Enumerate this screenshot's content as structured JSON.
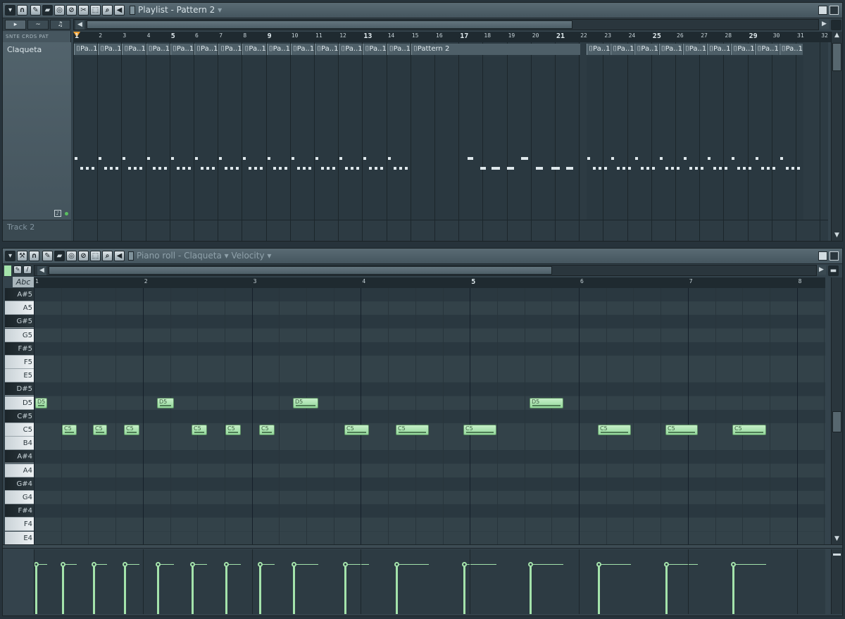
{
  "playlist": {
    "title": "Playlist",
    "title_sep": " - ",
    "pattern": "Pattern 2",
    "modes": "SNTE  CRDS  PAT",
    "tracks": [
      "Claqueta",
      "Track 2"
    ],
    "bars": [
      "1",
      "2",
      "3",
      "4",
      "5",
      "6",
      "7",
      "8",
      "9",
      "10",
      "11",
      "12",
      "13",
      "14",
      "15",
      "16",
      "17",
      "18",
      "19",
      "20",
      "21",
      "22",
      "23",
      "24",
      "25",
      "26",
      "27",
      "28",
      "29",
      "30",
      "31",
      "32"
    ],
    "clip_short": "Pa..1",
    "clip_long": "Pattern 2"
  },
  "pianoroll": {
    "title": "Piano roll",
    "channel": "Claqueta",
    "target": "Velocity",
    "abc": "Abc",
    "keys": [
      "A#5",
      "A5",
      "G#5",
      "G5",
      "F#5",
      "F5",
      "E5",
      "D#5",
      "D5",
      "C#5",
      "C5",
      "B4",
      "A#4",
      "A4",
      "G#4",
      "G4",
      "F#4",
      "F4",
      "E4"
    ],
    "bars": [
      "1",
      "2",
      "3",
      "4",
      "5",
      "6",
      "7",
      "8"
    ],
    "notes": [
      {
        "label": "D5"
      },
      {
        "label": "C5"
      },
      {
        "label": "C5"
      },
      {
        "label": "C5"
      },
      {
        "label": "D5"
      },
      {
        "label": "C5"
      },
      {
        "label": "C5"
      },
      {
        "label": "C5"
      },
      {
        "label": "D5"
      },
      {
        "label": "C5"
      },
      {
        "label": "C5"
      },
      {
        "label": "C5"
      },
      {
        "label": "D5"
      },
      {
        "label": "C5"
      },
      {
        "label": "C5"
      },
      {
        "label": "C5"
      }
    ]
  },
  "colors": {
    "note": "#a4e3ab",
    "background": "#2d3b43",
    "accent": "#f0a030"
  }
}
